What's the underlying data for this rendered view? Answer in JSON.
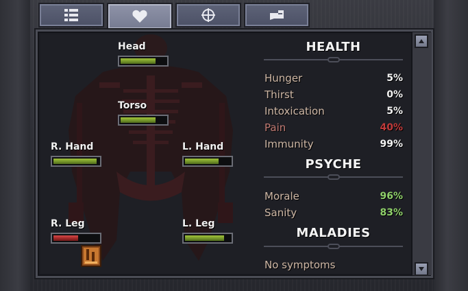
{
  "tabs": [
    {
      "icon": "list-icon",
      "active": false
    },
    {
      "icon": "heart-icon",
      "active": true
    },
    {
      "icon": "crosshair-icon",
      "active": false
    },
    {
      "icon": "hand-icon",
      "active": false
    }
  ],
  "limbs": {
    "head": {
      "label": "Head",
      "health": 0.78,
      "color": "green"
    },
    "torso": {
      "label": "Torso",
      "health": 0.78,
      "color": "green"
    },
    "r_hand": {
      "label": "R. Hand",
      "health": 0.96,
      "color": "green"
    },
    "l_hand": {
      "label": "L. Hand",
      "health": 0.74,
      "color": "green"
    },
    "r_leg": {
      "label": "R. Leg",
      "health": 0.55,
      "color": "red"
    },
    "l_leg": {
      "label": "L. Leg",
      "health": 0.86,
      "color": "green"
    }
  },
  "health": {
    "title": "HEALTH",
    "stats": [
      {
        "label": "Hunger",
        "value": "5%"
      },
      {
        "label": "Thirst",
        "value": "0%"
      },
      {
        "label": "Intoxication",
        "value": "5%"
      },
      {
        "label": "Pain",
        "value": "40%"
      },
      {
        "label": "Immunity",
        "value": "99%"
      }
    ]
  },
  "psyche": {
    "title": "PSYCHE",
    "stats": [
      {
        "label": "Morale",
        "value": "96%"
      },
      {
        "label": "Sanity",
        "value": "83%"
      }
    ]
  },
  "maladies": {
    "title": "MALADIES",
    "text": "No symptoms"
  },
  "colors": {
    "health_good": "#8fd06a",
    "pain": "#c03a3a",
    "bar_green": "#75962a",
    "bar_red": "#a02828"
  }
}
